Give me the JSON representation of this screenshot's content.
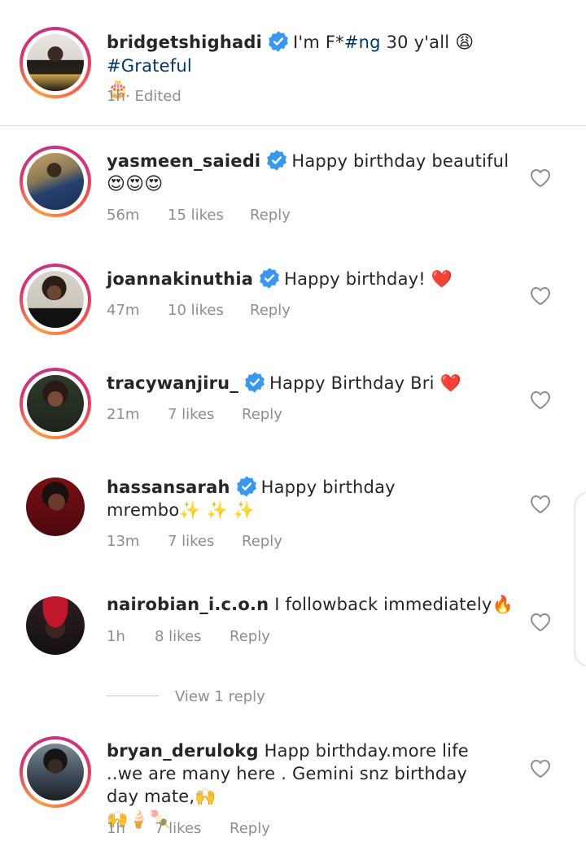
{
  "caption": {
    "username": "bridgetshighadi",
    "text_part1": "I'm F*",
    "hashtag1": "#ng",
    "text_part2": " 30 y'all ",
    "emoji1": "😩",
    "hashtag2": "#Grateful",
    "emoji2": "🎂",
    "time": "1h",
    "edited": "· Edited"
  },
  "comments": [
    {
      "username": "yasmeen_saiedi",
      "text": "Happy birthday beautiful",
      "emoji": "😍😍😍",
      "time": "56m",
      "likes": "15 likes",
      "reply": "Reply"
    },
    {
      "username": "joannakinuthia",
      "text": "Happy birthday! ❤️",
      "time": "47m",
      "likes": "10 likes",
      "reply": "Reply"
    },
    {
      "username": "tracywanjiru_",
      "text": "Happy Birthday Bri ❤️",
      "time": "21m",
      "likes": "7 likes",
      "reply": "Reply"
    },
    {
      "username": "hassansarah",
      "text": "Happy birthday",
      "text2": "mrembo✨ ✨ ✨",
      "time": "13m",
      "likes": "7 likes",
      "reply": "Reply"
    },
    {
      "username": "nairobian_i.c.o.n",
      "text": "I followback immediately🔥",
      "time": "1h",
      "likes": "8 likes",
      "reply": "Reply"
    },
    {
      "username": "bryan_derulokg",
      "text": "Happ birthday.more life ..we are many here . Gemini snz  birthday day mate,🙌",
      "text2": "🙌🍦🍡",
      "time": "1h",
      "likes": "7 likes",
      "reply": "Reply"
    }
  ],
  "view_replies": "View 1 reply",
  "icons": {
    "verified": "verified-badge-icon",
    "like": "heart-outline-icon"
  },
  "colors": {
    "verified": "#3897f0",
    "hashtag": "#00376b",
    "meta": "#8e8e8e"
  }
}
